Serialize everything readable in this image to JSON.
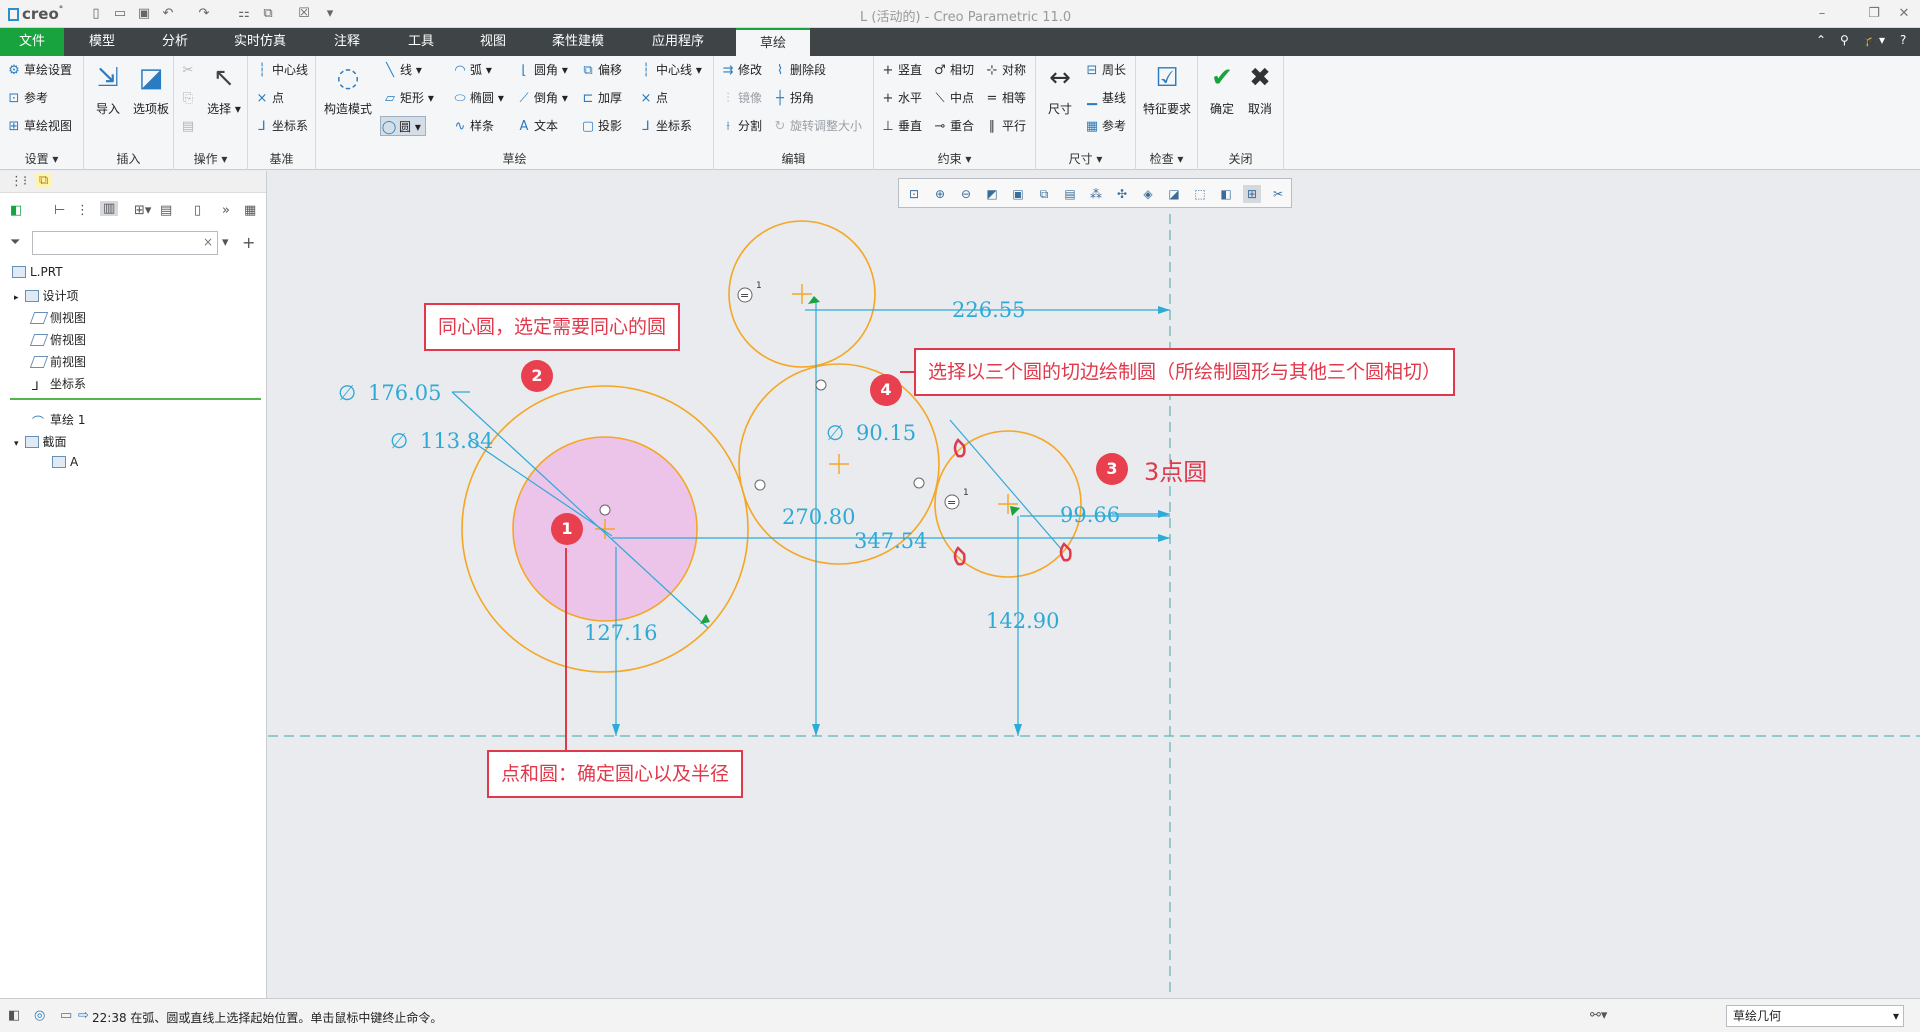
{
  "titlebar": {
    "logo": "creo",
    "window_title": "L (活动的) - Creo Parametric 11.0",
    "quick_access": [
      "new-icon",
      "open-icon",
      "save-icon",
      "undo-icon",
      "redo-icon",
      "regenerate-icon",
      "windows-icon",
      "close-window-icon",
      "customize-icon"
    ]
  },
  "tabs": [
    "文件",
    "模型",
    "分析",
    "实时仿真",
    "注释",
    "工具",
    "视图",
    "柔性建模",
    "应用程序",
    "草绘"
  ],
  "active_tab": "草绘",
  "ribbon": {
    "setup": {
      "label": "设置",
      "items": [
        "草绘设置",
        "参考",
        "草绘视图"
      ]
    },
    "insert": {
      "label": "插入",
      "items": [
        "导入",
        "选项板"
      ]
    },
    "operations": {
      "label": "操作",
      "items": [
        "选择"
      ]
    },
    "datum": {
      "label": "基准",
      "items": [
        "中心线",
        "点",
        "坐标系"
      ]
    },
    "sketch": {
      "label": "草绘",
      "construction": "构造模式",
      "col1": [
        "线",
        "矩形",
        "圆"
      ],
      "col2": [
        "弧",
        "椭圆",
        "样条"
      ],
      "col3": [
        "圆角",
        "倒角",
        "文本"
      ],
      "col4": [
        "偏移",
        "加厚",
        "投影"
      ],
      "col5": [
        "中心线",
        "点",
        "坐标系"
      ]
    },
    "edit": {
      "label": "编辑",
      "col1": [
        "修改",
        "镜像",
        "分割"
      ],
      "col2": [
        "删除段",
        "拐角",
        "旋转调整大小"
      ]
    },
    "constrain": {
      "label": "约束",
      "col1": [
        "竖直",
        "水平",
        "垂直"
      ],
      "col2": [
        "相切",
        "中点",
        "重合"
      ],
      "col3": [
        "对称",
        "相等",
        "平行"
      ]
    },
    "dimension": {
      "label": "尺寸",
      "big": "尺寸",
      "items": [
        "周长",
        "基线",
        "参考"
      ]
    },
    "inspect": {
      "label": "检查",
      "big": "特征要求"
    },
    "close": {
      "label": "关闭",
      "ok": "确定",
      "cancel": "取消"
    }
  },
  "model_tree": {
    "root": "L.PRT",
    "items": [
      "设计项",
      "侧视图",
      "俯视图",
      "前视图",
      "坐标系"
    ],
    "features": [
      "草绘 1",
      "截面",
      "A"
    ]
  },
  "sketch": {
    "dims": {
      "d_outer": "176.05",
      "d_inner": "113.84",
      "d_mid": "90.15",
      "r_small": "226.55",
      "h1": "127.16",
      "h2": "270.80",
      "h3": "347.54",
      "h4": "142.90",
      "h5": "99.66"
    },
    "dia_symbol": "∅",
    "constraint_marks": [
      "=",
      "1"
    ]
  },
  "annotations": {
    "a1": {
      "num": "1",
      "text": "点和圆：确定圆心以及半径"
    },
    "a2": {
      "num": "2",
      "text": "同心圆，选定需要同心的圆"
    },
    "a3": {
      "num": "3",
      "text": "3点圆"
    },
    "a4": {
      "num": "4",
      "text": "选择以三个圆的切边绘制圆（所绘制圆形与其他三个圆相切）"
    }
  },
  "statusbar": {
    "message": "22:38 在弧、圆或直线上选择起始位置。单击鼠标中键终止命令。",
    "filter": "草绘几何"
  },
  "colors": {
    "accent_green": "#18a33f",
    "sketch_orange": "#f5a623",
    "dim_blue": "#2eaad6",
    "annotation_red": "#e0394b",
    "highlight_pink": "#ecc4ea"
  }
}
